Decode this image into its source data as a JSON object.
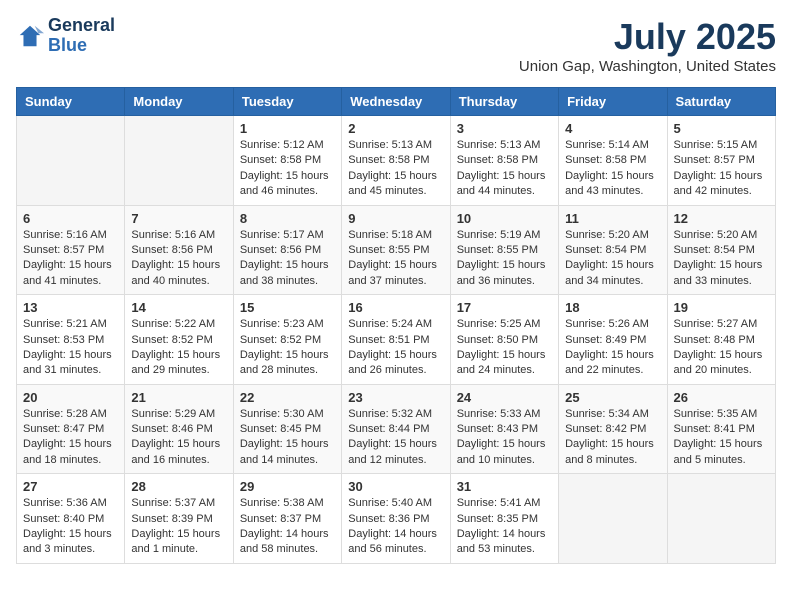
{
  "logo": {
    "general": "General",
    "blue": "Blue"
  },
  "title": "July 2025",
  "location": "Union Gap, Washington, United States",
  "weekdays": [
    "Sunday",
    "Monday",
    "Tuesday",
    "Wednesday",
    "Thursday",
    "Friday",
    "Saturday"
  ],
  "weeks": [
    [
      {
        "day": "",
        "info": ""
      },
      {
        "day": "",
        "info": ""
      },
      {
        "day": "1",
        "info": "Sunrise: 5:12 AM\nSunset: 8:58 PM\nDaylight: 15 hours and 46 minutes."
      },
      {
        "day": "2",
        "info": "Sunrise: 5:13 AM\nSunset: 8:58 PM\nDaylight: 15 hours and 45 minutes."
      },
      {
        "day": "3",
        "info": "Sunrise: 5:13 AM\nSunset: 8:58 PM\nDaylight: 15 hours and 44 minutes."
      },
      {
        "day": "4",
        "info": "Sunrise: 5:14 AM\nSunset: 8:58 PM\nDaylight: 15 hours and 43 minutes."
      },
      {
        "day": "5",
        "info": "Sunrise: 5:15 AM\nSunset: 8:57 PM\nDaylight: 15 hours and 42 minutes."
      }
    ],
    [
      {
        "day": "6",
        "info": "Sunrise: 5:16 AM\nSunset: 8:57 PM\nDaylight: 15 hours and 41 minutes."
      },
      {
        "day": "7",
        "info": "Sunrise: 5:16 AM\nSunset: 8:56 PM\nDaylight: 15 hours and 40 minutes."
      },
      {
        "day": "8",
        "info": "Sunrise: 5:17 AM\nSunset: 8:56 PM\nDaylight: 15 hours and 38 minutes."
      },
      {
        "day": "9",
        "info": "Sunrise: 5:18 AM\nSunset: 8:55 PM\nDaylight: 15 hours and 37 minutes."
      },
      {
        "day": "10",
        "info": "Sunrise: 5:19 AM\nSunset: 8:55 PM\nDaylight: 15 hours and 36 minutes."
      },
      {
        "day": "11",
        "info": "Sunrise: 5:20 AM\nSunset: 8:54 PM\nDaylight: 15 hours and 34 minutes."
      },
      {
        "day": "12",
        "info": "Sunrise: 5:20 AM\nSunset: 8:54 PM\nDaylight: 15 hours and 33 minutes."
      }
    ],
    [
      {
        "day": "13",
        "info": "Sunrise: 5:21 AM\nSunset: 8:53 PM\nDaylight: 15 hours and 31 minutes."
      },
      {
        "day": "14",
        "info": "Sunrise: 5:22 AM\nSunset: 8:52 PM\nDaylight: 15 hours and 29 minutes."
      },
      {
        "day": "15",
        "info": "Sunrise: 5:23 AM\nSunset: 8:52 PM\nDaylight: 15 hours and 28 minutes."
      },
      {
        "day": "16",
        "info": "Sunrise: 5:24 AM\nSunset: 8:51 PM\nDaylight: 15 hours and 26 minutes."
      },
      {
        "day": "17",
        "info": "Sunrise: 5:25 AM\nSunset: 8:50 PM\nDaylight: 15 hours and 24 minutes."
      },
      {
        "day": "18",
        "info": "Sunrise: 5:26 AM\nSunset: 8:49 PM\nDaylight: 15 hours and 22 minutes."
      },
      {
        "day": "19",
        "info": "Sunrise: 5:27 AM\nSunset: 8:48 PM\nDaylight: 15 hours and 20 minutes."
      }
    ],
    [
      {
        "day": "20",
        "info": "Sunrise: 5:28 AM\nSunset: 8:47 PM\nDaylight: 15 hours and 18 minutes."
      },
      {
        "day": "21",
        "info": "Sunrise: 5:29 AM\nSunset: 8:46 PM\nDaylight: 15 hours and 16 minutes."
      },
      {
        "day": "22",
        "info": "Sunrise: 5:30 AM\nSunset: 8:45 PM\nDaylight: 15 hours and 14 minutes."
      },
      {
        "day": "23",
        "info": "Sunrise: 5:32 AM\nSunset: 8:44 PM\nDaylight: 15 hours and 12 minutes."
      },
      {
        "day": "24",
        "info": "Sunrise: 5:33 AM\nSunset: 8:43 PM\nDaylight: 15 hours and 10 minutes."
      },
      {
        "day": "25",
        "info": "Sunrise: 5:34 AM\nSunset: 8:42 PM\nDaylight: 15 hours and 8 minutes."
      },
      {
        "day": "26",
        "info": "Sunrise: 5:35 AM\nSunset: 8:41 PM\nDaylight: 15 hours and 5 minutes."
      }
    ],
    [
      {
        "day": "27",
        "info": "Sunrise: 5:36 AM\nSunset: 8:40 PM\nDaylight: 15 hours and 3 minutes."
      },
      {
        "day": "28",
        "info": "Sunrise: 5:37 AM\nSunset: 8:39 PM\nDaylight: 15 hours and 1 minute."
      },
      {
        "day": "29",
        "info": "Sunrise: 5:38 AM\nSunset: 8:37 PM\nDaylight: 14 hours and 58 minutes."
      },
      {
        "day": "30",
        "info": "Sunrise: 5:40 AM\nSunset: 8:36 PM\nDaylight: 14 hours and 56 minutes."
      },
      {
        "day": "31",
        "info": "Sunrise: 5:41 AM\nSunset: 8:35 PM\nDaylight: 14 hours and 53 minutes."
      },
      {
        "day": "",
        "info": ""
      },
      {
        "day": "",
        "info": ""
      }
    ]
  ]
}
